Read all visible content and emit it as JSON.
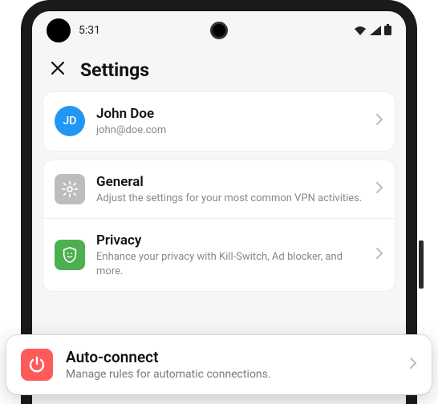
{
  "status": {
    "time": "5:31"
  },
  "header": {
    "title": "Settings"
  },
  "profile": {
    "initials": "JD",
    "name": "John Doe",
    "email": "john@doe.com"
  },
  "sections": {
    "general": {
      "title": "General",
      "subtitle": "Adjust the settings for your most common VPN activities."
    },
    "privacy": {
      "title": "Privacy",
      "subtitle": "Enhance your privacy with Kill-Switch, Ad blocker, and more."
    },
    "autoconnect": {
      "title": "Auto-connect",
      "subtitle": "Manage rules for automatic connections."
    }
  },
  "colors": {
    "accent_blue": "#2196f3",
    "privacy_green": "#4caf50",
    "general_gray": "#bdbdbd",
    "autoconnect_red": "#ff5a5a"
  }
}
